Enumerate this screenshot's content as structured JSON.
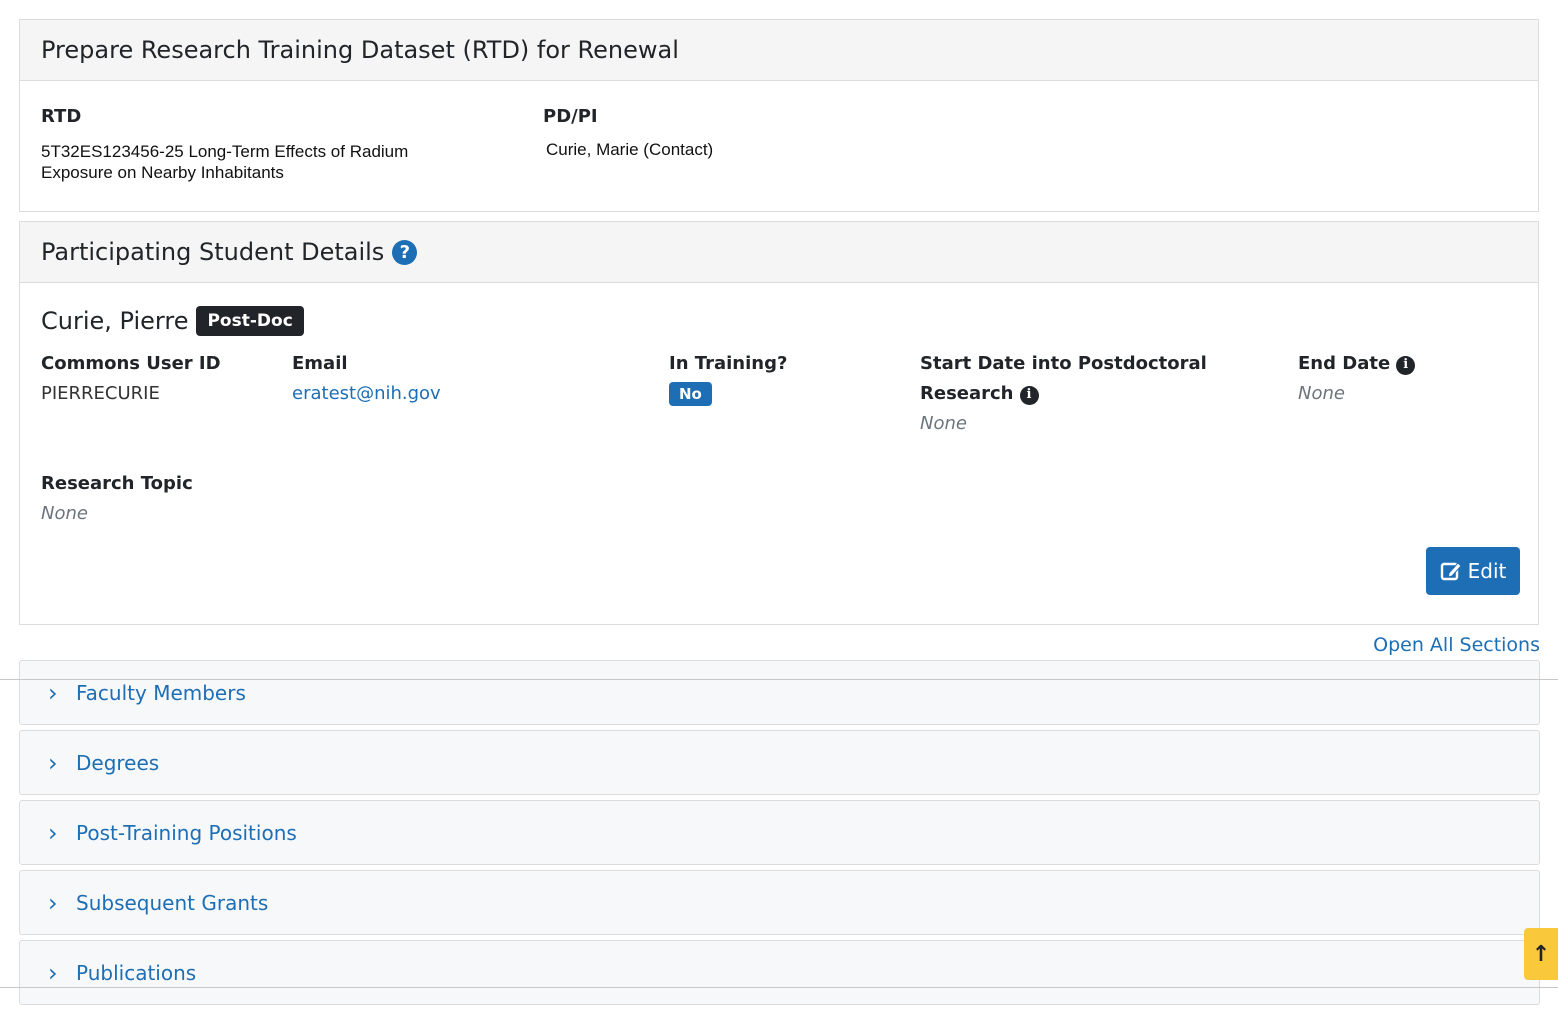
{
  "rtd_card": {
    "title": "Prepare Research Training Dataset (RTD) for Renewal",
    "rtd_label": "RTD",
    "rtd_value": "5T32ES123456-25 Long-Term Effects of Radium Exposure on Nearby Inhabitants",
    "pdpi_label": "PD/PI",
    "pdpi_value": "Curie, Marie (Contact)"
  },
  "student_card": {
    "title": "Participating Student Details",
    "help_icon": "question-circle-icon",
    "name": "Curie, Pierre",
    "role_badge": "Post-Doc",
    "commons_id_label": "Commons User ID",
    "commons_id_value": "PIERRECURIE",
    "email_label": "Email",
    "email_value": "eratest@nih.gov",
    "in_training_label": "In Training?",
    "in_training_value": "No",
    "start_date_label": "Start Date into Postdoctoral Research",
    "start_date_value": "None",
    "end_date_label": "End Date",
    "end_date_value": "None",
    "research_topic_label": "Research Topic",
    "research_topic_value": "None",
    "edit_label": "Edit",
    "edit_icon": "edit-icon"
  },
  "open_all_label": "Open All Sections",
  "sections": [
    {
      "label": "Faculty Members"
    },
    {
      "label": "Degrees"
    },
    {
      "label": "Post-Training Positions"
    },
    {
      "label": "Subsequent Grants"
    },
    {
      "label": "Publications"
    }
  ],
  "scroll_top_icon": "arrow-up-icon",
  "colors": {
    "accent": "#1d6eb5",
    "scroll_button": "#f9c93b",
    "badge_dark": "#212529"
  }
}
